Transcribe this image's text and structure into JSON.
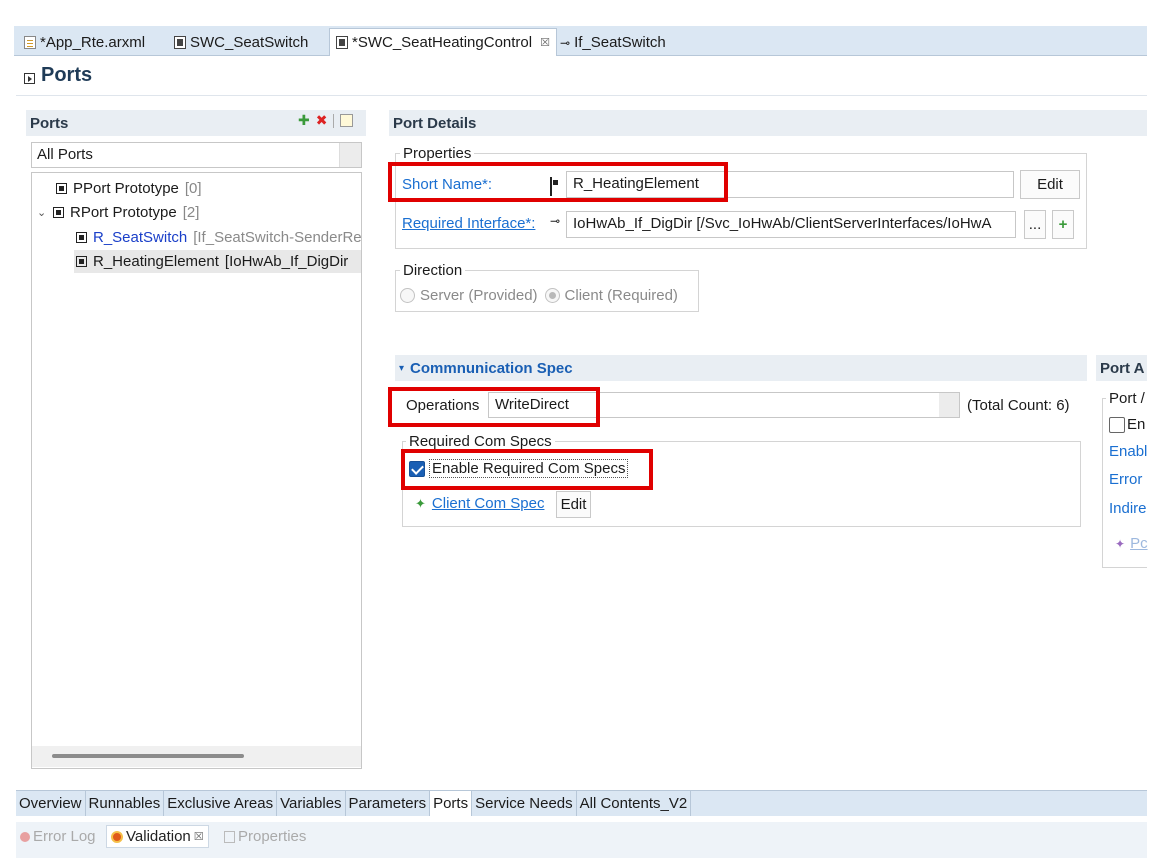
{
  "editor_tabs": [
    {
      "label": "*App_Rte.arxml",
      "icon": "file-icon"
    },
    {
      "label": "SWC_SeatSwitch",
      "icon": "component-icon"
    },
    {
      "label": "*SWC_SeatHeatingControl",
      "icon": "component-icon",
      "active": true,
      "close": "☒"
    },
    {
      "label": "If_SeatSwitch",
      "icon": "interface-icon"
    }
  ],
  "page_title": "Ports",
  "ports_panel": {
    "header": "Ports",
    "filter_value": "All Ports",
    "tree": {
      "pport": {
        "label": "PPort Prototype",
        "count": "[0]"
      },
      "rport": {
        "label": "RPort Prototype",
        "count": "[2]"
      },
      "items": [
        {
          "name": "R_SeatSwitch",
          "detail": "[If_SeatSwitch-SenderRe"
        },
        {
          "name": "R_HeatingElement",
          "detail": "[IoHwAb_If_DigDir"
        }
      ]
    }
  },
  "port_details": {
    "header": "Port Details",
    "properties_label": "Properties",
    "short_name_label": "Short Name*:",
    "short_name_value": "R_HeatingElement",
    "edit_label": "Edit",
    "required_interface_label": "Required Interface*:",
    "required_interface_value": "IoHwAb_If_DigDir [/Svc_IoHwAb/ClientServerInterfaces/IoHwA",
    "browse_label": "...",
    "add_label": "+",
    "direction_label": "Direction",
    "server_label": "Server (Provided)",
    "client_label": "Client (Required)"
  },
  "comm_spec": {
    "header": "Commnunication Spec",
    "operations_label": "Operations",
    "operations_value": "WriteDirect",
    "total_count": "(Total Count: 6)",
    "required_group_label": "Required Com Specs",
    "enable_label": "Enable Required Com Specs",
    "enable_checked": true,
    "client_com_spec_label": "Client Com Spec",
    "client_edit_label": "Edit"
  },
  "port_annotations": {
    "header": "Port A",
    "group_label": "Port /",
    "enable_text": "En",
    "link1": "Enabl",
    "link2": "Error",
    "link3": "Indire",
    "link4": "Pc"
  },
  "bottom_tabs": [
    "Overview",
    "Runnables",
    "Exclusive Areas",
    "Variables",
    "Parameters",
    "Ports",
    "Service Needs",
    "All Contents_V2"
  ],
  "bottom_tabs_active": "Ports",
  "view_tabs": [
    {
      "label": "Error Log"
    },
    {
      "label": "Validation",
      "close": "☒"
    },
    {
      "label": "Properties"
    }
  ],
  "colors": {
    "highlight": "#e00000",
    "link": "#1a6fd1",
    "tab_strip": "#dbe7f3",
    "check": "#1a5fb4"
  }
}
